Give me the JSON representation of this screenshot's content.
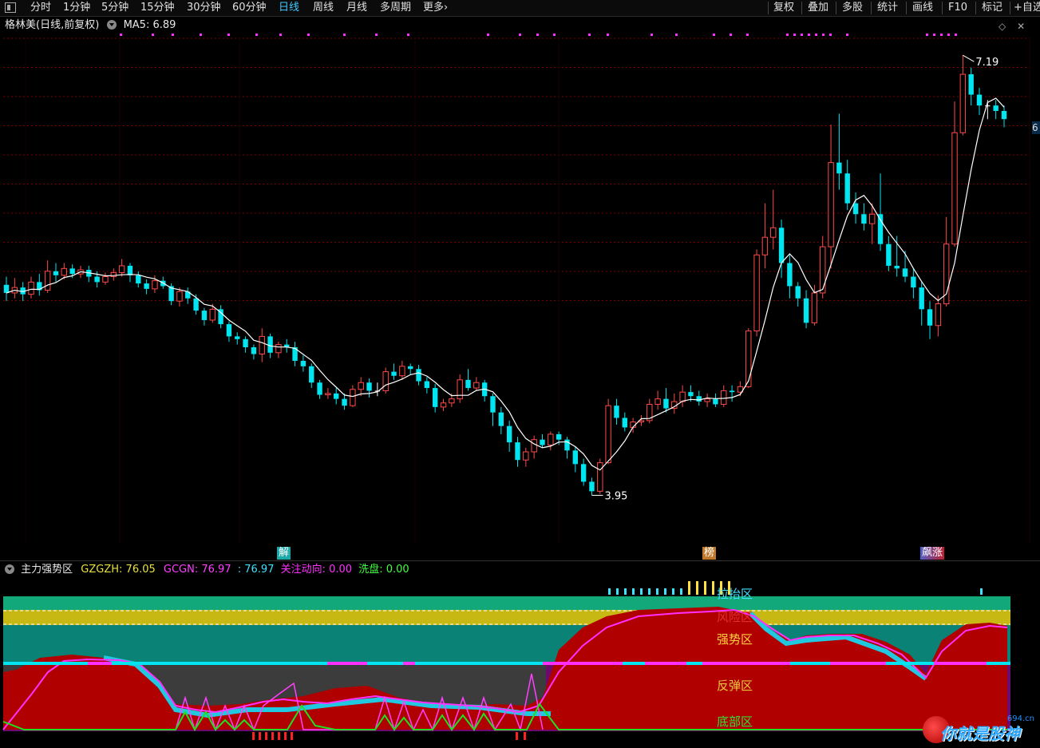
{
  "toolbar": {
    "periods": [
      "分时",
      "1分钟",
      "5分钟",
      "15分钟",
      "30分钟",
      "60分钟",
      "日线",
      "周线",
      "月线",
      "多周期",
      "更多"
    ],
    "active_period": "日线",
    "more_arrow": "›",
    "right_buttons": [
      "复权",
      "叠加",
      "多股",
      "统计",
      "画线",
      "F10",
      "标记",
      "+自选"
    ]
  },
  "stock": {
    "title": "格林美(日线,前复权)",
    "ma_label": "MA5: 6.89",
    "right_edge_label": "6"
  },
  "price_labels": {
    "high": "7.19",
    "low": "3.95"
  },
  "signal_tags": [
    {
      "text": "解",
      "color": "#1aa8a8"
    },
    {
      "text": "榜",
      "color": "#c0792a"
    },
    {
      "text": "飙涨",
      "color": "#5060c8"
    }
  ],
  "indicator": {
    "name": "主力强势区",
    "items": [
      {
        "text": "GZGZH: 76.05",
        "color": "#e8e040"
      },
      {
        "text": "GCGN: 76.97",
        "color": "#ff40ff"
      },
      {
        "text": ": 76.97",
        "color": "#40e0ff"
      },
      {
        "text": "关注动向: 0.00",
        "color": "#ff30ff"
      },
      {
        "text": "洗盘: 0.00",
        "color": "#40ff40"
      }
    ],
    "zones": [
      {
        "text": "拉抬区",
        "color": "#40e0ff"
      },
      {
        "text": "风险区",
        "color": "#e03030"
      },
      {
        "text": "强势区",
        "color": "#ffd040"
      },
      {
        "text": "反弹区",
        "color": "#e8c840"
      },
      {
        "text": "底部区",
        "color": "#30e030"
      }
    ]
  },
  "watermark": {
    "text": "你就是股神",
    "site": "694.cn"
  },
  "colors": {
    "up": "#ff4a4a",
    "down": "#00e5f0",
    "ma": "#ffffff",
    "grid": "#7a0000"
  },
  "chart_data": {
    "type": "candlestick",
    "series_name": "MA5",
    "ylim": [
      3.6,
      7.35
    ],
    "candles": [
      [
        5.5,
        5.44,
        5.56,
        5.38
      ],
      [
        5.44,
        5.48,
        5.55,
        5.4
      ],
      [
        5.48,
        5.43,
        5.52,
        5.38
      ],
      [
        5.43,
        5.52,
        5.56,
        5.4
      ],
      [
        5.52,
        5.46,
        5.58,
        5.42
      ],
      [
        5.46,
        5.6,
        5.68,
        5.44
      ],
      [
        5.6,
        5.57,
        5.66,
        5.52
      ],
      [
        5.57,
        5.62,
        5.66,
        5.54
      ],
      [
        5.62,
        5.58,
        5.65,
        5.55
      ],
      [
        5.58,
        5.61,
        5.64,
        5.55
      ],
      [
        5.61,
        5.56,
        5.64,
        5.52
      ],
      [
        5.56,
        5.52,
        5.6,
        5.48
      ],
      [
        5.52,
        5.56,
        5.59,
        5.5
      ],
      [
        5.56,
        5.59,
        5.62,
        5.53
      ],
      [
        5.59,
        5.64,
        5.69,
        5.56
      ],
      [
        5.64,
        5.57,
        5.66,
        5.52
      ],
      [
        5.57,
        5.51,
        5.6,
        5.48
      ],
      [
        5.51,
        5.47,
        5.54,
        5.43
      ],
      [
        5.47,
        5.53,
        5.57,
        5.44
      ],
      [
        5.53,
        5.49,
        5.56,
        5.47
      ],
      [
        5.49,
        5.38,
        5.51,
        5.35
      ],
      [
        5.38,
        5.45,
        5.48,
        5.34
      ],
      [
        5.45,
        5.4,
        5.48,
        5.36
      ],
      [
        5.4,
        5.31,
        5.43,
        5.28
      ],
      [
        5.31,
        5.24,
        5.33,
        5.2
      ],
      [
        5.24,
        5.32,
        5.36,
        5.22
      ],
      [
        5.32,
        5.21,
        5.35,
        5.18
      ],
      [
        5.21,
        5.12,
        5.23,
        5.08
      ],
      [
        5.12,
        5.1,
        5.15,
        5.06
      ],
      [
        5.1,
        5.04,
        5.12,
        5.0
      ],
      [
        5.04,
        4.99,
        5.06,
        4.95
      ],
      [
        4.99,
        5.12,
        5.18,
        4.93
      ],
      [
        5.12,
        5.0,
        5.14,
        4.96
      ],
      [
        5.0,
        5.06,
        5.08,
        4.96
      ],
      [
        5.06,
        5.04,
        5.1,
        5.0
      ],
      [
        5.04,
        4.94,
        5.08,
        4.9
      ],
      [
        4.94,
        4.9,
        4.98,
        4.86
      ],
      [
        4.9,
        4.78,
        4.92,
        4.74
      ],
      [
        4.78,
        4.69,
        4.8,
        4.66
      ],
      [
        4.69,
        4.7,
        4.74,
        4.66
      ],
      [
        4.7,
        4.66,
        4.74,
        4.62
      ],
      [
        4.66,
        4.61,
        4.7,
        4.58
      ],
      [
        4.61,
        4.73,
        4.76,
        4.6
      ],
      [
        4.73,
        4.78,
        4.82,
        4.68
      ],
      [
        4.78,
        4.72,
        4.81,
        4.67
      ],
      [
        4.72,
        4.72,
        4.78,
        4.68
      ],
      [
        4.72,
        4.86,
        4.89,
        4.7
      ],
      [
        4.86,
        4.83,
        4.92,
        4.8
      ],
      [
        4.83,
        4.9,
        4.94,
        4.8
      ],
      [
        4.9,
        4.88,
        4.92,
        4.84
      ],
      [
        4.88,
        4.79,
        4.91,
        4.76
      ],
      [
        4.79,
        4.74,
        4.82,
        4.7
      ],
      [
        4.74,
        4.6,
        4.77,
        4.56
      ],
      [
        4.6,
        4.63,
        4.66,
        4.57
      ],
      [
        4.63,
        4.66,
        4.7,
        4.6
      ],
      [
        4.66,
        4.8,
        4.84,
        4.63
      ],
      [
        4.8,
        4.74,
        4.88,
        4.72
      ],
      [
        4.74,
        4.78,
        4.82,
        4.72
      ],
      [
        4.78,
        4.68,
        4.8,
        4.64
      ],
      [
        4.68,
        4.56,
        4.7,
        4.46
      ],
      [
        4.56,
        4.46,
        4.6,
        4.4
      ],
      [
        4.46,
        4.34,
        4.5,
        4.27
      ],
      [
        4.34,
        4.21,
        4.38,
        4.16
      ],
      [
        4.21,
        4.27,
        4.3,
        4.16
      ],
      [
        4.27,
        4.36,
        4.39,
        4.22
      ],
      [
        4.36,
        4.32,
        4.4,
        4.3
      ],
      [
        4.32,
        4.4,
        4.42,
        4.28
      ],
      [
        4.4,
        4.36,
        4.42,
        4.32
      ],
      [
        4.36,
        4.28,
        4.38,
        4.22
      ],
      [
        4.28,
        4.18,
        4.31,
        4.12
      ],
      [
        4.18,
        4.05,
        4.22,
        4.02
      ],
      [
        4.05,
        3.98,
        4.08,
        3.95
      ],
      [
        3.98,
        4.19,
        4.22,
        3.96
      ],
      [
        4.19,
        4.61,
        4.66,
        4.18
      ],
      [
        4.61,
        4.52,
        4.66,
        4.47
      ],
      [
        4.52,
        4.45,
        4.56,
        4.42
      ],
      [
        4.45,
        4.49,
        4.52,
        4.41
      ],
      [
        4.49,
        4.5,
        4.54,
        4.46
      ],
      [
        4.5,
        4.62,
        4.66,
        4.48
      ],
      [
        4.62,
        4.66,
        4.72,
        4.58
      ],
      [
        4.66,
        4.59,
        4.74,
        4.56
      ],
      [
        4.59,
        4.64,
        4.7,
        4.55
      ],
      [
        4.64,
        4.71,
        4.76,
        4.6
      ],
      [
        4.71,
        4.68,
        4.76,
        4.64
      ],
      [
        4.68,
        4.64,
        4.72,
        4.61
      ],
      [
        4.64,
        4.66,
        4.7,
        4.6
      ],
      [
        4.66,
        4.62,
        4.7,
        4.6
      ],
      [
        4.62,
        4.72,
        4.76,
        4.6
      ],
      [
        4.72,
        4.71,
        4.76,
        4.64
      ],
      [
        4.71,
        4.75,
        4.79,
        4.68
      ],
      [
        4.75,
        5.16,
        5.18,
        4.74
      ],
      [
        5.16,
        5.72,
        5.76,
        5.12
      ],
      [
        5.72,
        5.85,
        6.1,
        5.62
      ],
      [
        5.85,
        5.92,
        6.2,
        5.76
      ],
      [
        5.92,
        5.66,
        5.98,
        5.55
      ],
      [
        5.66,
        5.49,
        5.72,
        5.4
      ],
      [
        5.49,
        5.4,
        5.52,
        5.34
      ],
      [
        5.4,
        5.22,
        5.46,
        5.18
      ],
      [
        5.22,
        5.44,
        5.5,
        5.2
      ],
      [
        5.44,
        5.78,
        5.86,
        5.4
      ],
      [
        5.78,
        6.4,
        6.68,
        5.62
      ],
      [
        6.4,
        6.32,
        6.76,
        6.2
      ],
      [
        6.32,
        6.1,
        6.42,
        6.05
      ],
      [
        6.1,
        6.02,
        6.18,
        5.95
      ],
      [
        6.02,
        5.95,
        6.1,
        5.9
      ],
      [
        5.95,
        6.02,
        6.1,
        5.8
      ],
      [
        6.02,
        5.8,
        6.32,
        5.75
      ],
      [
        5.8,
        5.64,
        5.86,
        5.6
      ],
      [
        5.64,
        5.62,
        5.86,
        5.56
      ],
      [
        5.62,
        5.56,
        5.75,
        5.52
      ],
      [
        5.56,
        5.48,
        5.62,
        5.4
      ],
      [
        5.48,
        5.32,
        5.52,
        5.2
      ],
      [
        5.32,
        5.2,
        5.38,
        5.1
      ],
      [
        5.2,
        5.36,
        5.42,
        5.12
      ],
      [
        5.36,
        5.8,
        6.0,
        5.34
      ],
      [
        5.8,
        6.62,
        6.85,
        5.78
      ],
      [
        6.62,
        7.05,
        7.19,
        6.6
      ],
      [
        7.05,
        6.9,
        7.1,
        6.82
      ],
      [
        6.9,
        6.82,
        6.95,
        6.75
      ],
      [
        6.82,
        6.82,
        6.86,
        6.72
      ],
      [
        6.82,
        6.78,
        6.86,
        6.72
      ],
      [
        6.78,
        6.72,
        6.82,
        6.66
      ]
    ]
  }
}
